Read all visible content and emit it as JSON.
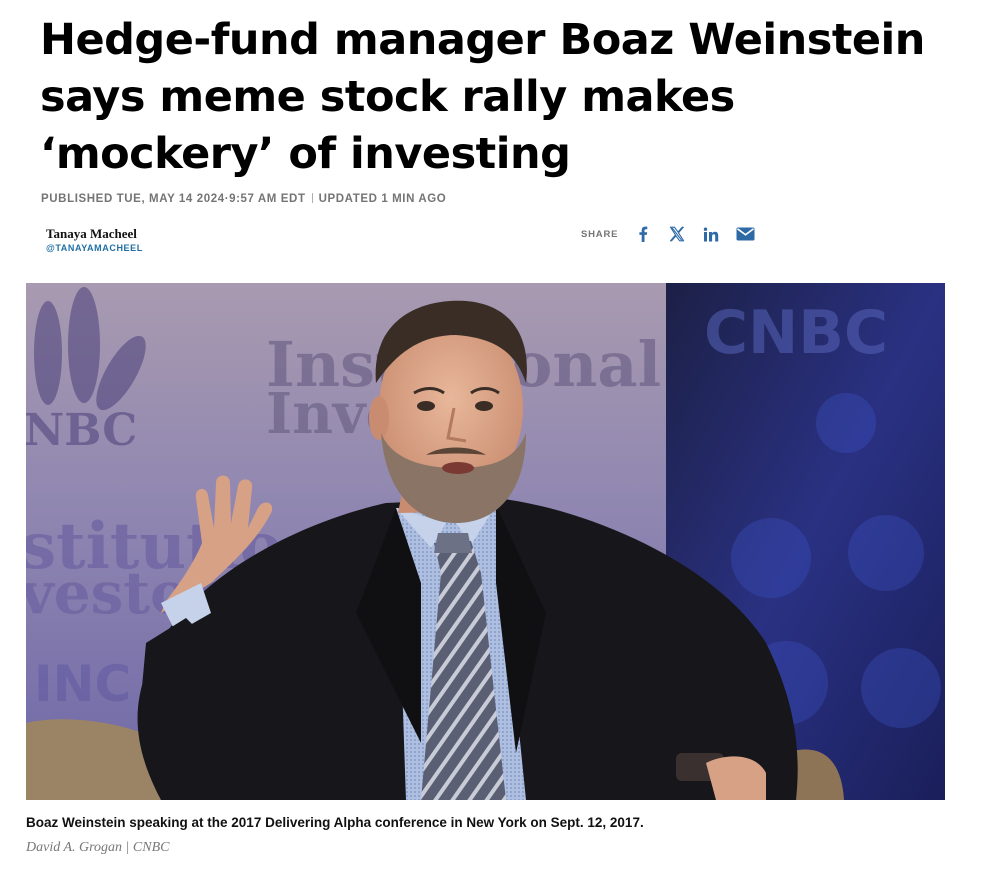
{
  "article": {
    "headline": "Hedge-fund manager Boaz Weinstein says meme stock rally makes ‘mockery’ of investing",
    "published": "PUBLISHED TUE, MAY 14 2024·9:57 AM EDT",
    "updated": "UPDATED 1 MIN AGO"
  },
  "author": {
    "name": "Tanaya Macheel",
    "handle": "@TANAYAMACHEEL"
  },
  "share": {
    "label": "SHARE",
    "buttons": [
      {
        "icon": "facebook-icon"
      },
      {
        "icon": "x-icon"
      },
      {
        "icon": "linkedin-icon"
      },
      {
        "icon": "email-icon"
      }
    ]
  },
  "photo": {
    "backdrop_text_1": "Instit",
    "backdrop_text_2": "onal",
    "backdrop_text_3": "Inve",
    "backdrop_text_4": "stitutio",
    "backdrop_text_5": "vestor",
    "backdrop_text_6": "INC",
    "backdrop_logo_left": "NBC",
    "backdrop_logo_right": "CNBC"
  },
  "caption": "Boaz Weinstein speaking at the 2017 Delivering Alpha conference in New York on Sept. 12, 2017.",
  "credit": "David A. Grogan | CNBC",
  "colors": {
    "link_blue": "#2e6aa6",
    "handle_blue": "#1f6fa6",
    "meta_gray": "#747474"
  }
}
